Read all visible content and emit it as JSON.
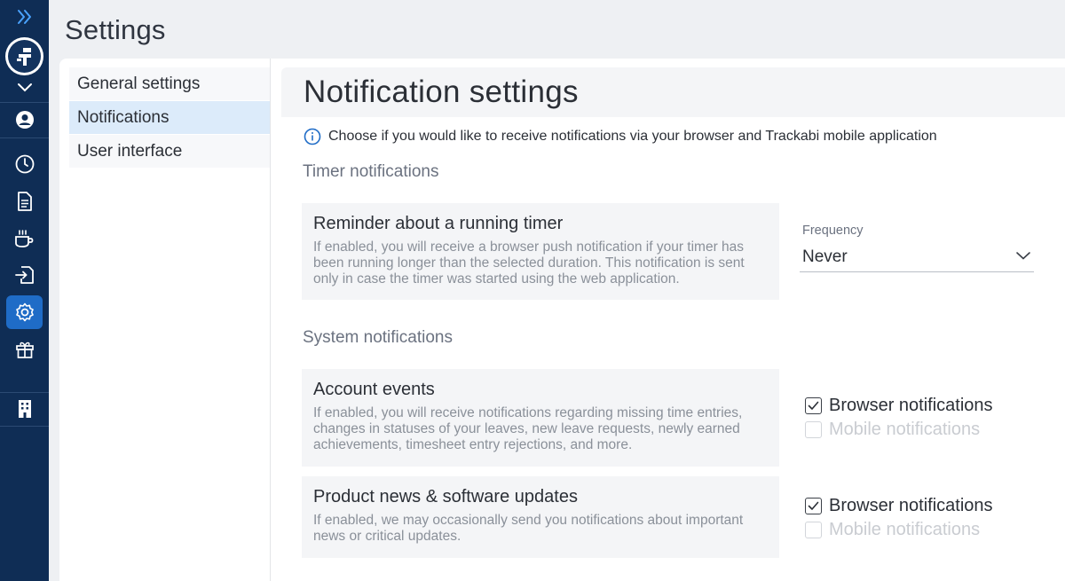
{
  "header": {
    "title": "Settings"
  },
  "rail": {
    "icons": [
      "expand-icon",
      "logo",
      "chevron-down-icon",
      "profile-icon",
      "timer-icon",
      "document-icon",
      "coffee-icon",
      "import-icon",
      "settings-icon",
      "gift-icon",
      "building-icon"
    ],
    "active": "settings-icon"
  },
  "subnav": {
    "items": [
      {
        "label": "General settings"
      },
      {
        "label": "Notifications"
      },
      {
        "label": "User interface"
      }
    ]
  },
  "main": {
    "title": "Notification settings",
    "info": "Choose if you would like to receive notifications via your browser and Trackabi mobile application",
    "timer_section": {
      "title": "Timer notifications",
      "reminder": {
        "title": "Reminder about a running timer",
        "description": "If enabled, you will receive a browser push notification if your timer has been running longer than the selected duration. This notification is sent only in case the timer was started using the web application."
      },
      "frequency": {
        "label": "Frequency",
        "value": "Never"
      }
    },
    "system_section": {
      "title": "System notifications",
      "account_events": {
        "title": "Account events",
        "description": "If enabled, you will receive notifications regarding missing time entries, changes in statuses of your leaves, new leave requests, newly earned achievements, timesheet entry rejections, and more.",
        "browser_label": "Browser notifications",
        "browser_checked": true,
        "mobile_label": "Mobile notifications",
        "mobile_checked": false
      },
      "product_news": {
        "title": "Product news & software updates",
        "description": "If enabled, we may occasionally send you notifications about important news or critical updates.",
        "browser_label": "Browser notifications",
        "browser_checked": true,
        "mobile_label": "Mobile notifications",
        "mobile_checked": false
      }
    }
  },
  "colors": {
    "rail_bg": "#0f2d55",
    "rail_active": "#1f6cc7",
    "subnav_active": "#dcebfa",
    "info_icon": "#1f6cc7"
  }
}
